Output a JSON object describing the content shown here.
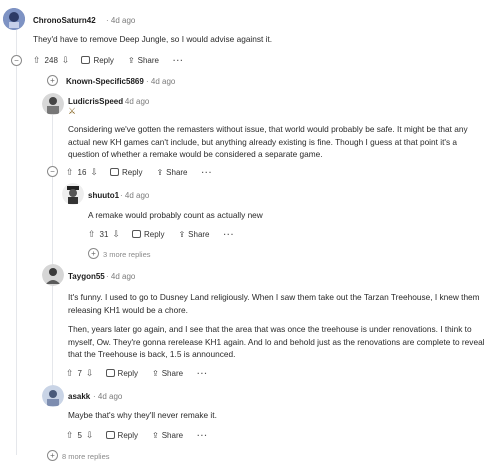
{
  "comments": {
    "c1": {
      "username": "ChronoSaturn42",
      "time": "· 4d ago",
      "text": "They'd have to remove Deep Jungle, so I would advise against it.",
      "votes": "248",
      "reply": "Reply",
      "share": "Share",
      "more": "···"
    },
    "c2": {
      "username": "Known-Specific5869",
      "time": "· 4d ago"
    },
    "c3": {
      "username": "LudicrisSpeed",
      "time": "· 4d ago",
      "text": "Considering we've gotten the remasters without issue, that world would probably be safe. It might be that any actual new KH games can't include, but anything already existing is fine. Though I guess at that point it's a question of whether a remake would be considered a separate game.",
      "votes": "16",
      "reply": "Reply",
      "share": "Share",
      "more": "···"
    },
    "c4": {
      "username": "shuuto1",
      "time": "· 4d ago",
      "text": "A remake would probably count as actually new",
      "votes": "31",
      "reply": "Reply",
      "share": "Share",
      "more": "···",
      "more_replies": "3 more replies"
    },
    "c5": {
      "username": "Taygon55",
      "time": "· 4d ago",
      "text1": "It's funny. I used to go to Dusney Land religiously. When I saw them take out the Tarzan Treehouse, I knew them releasing KH1 would be a chore.",
      "text2": "Then, years later go again, and I see that the area that was once the treehouse is under renovations. I think to myself, Ow. They're gonna rerelease KH1 again. And lo and behold just as the renovations are complete to reveal that the Treehouse is back, 1.5 is announced.",
      "votes": "7",
      "reply": "Reply",
      "share": "Share",
      "more": "···"
    },
    "c6": {
      "username": "asakk",
      "time": "· 4d ago",
      "text": "Maybe that's why they'll never remake it.",
      "votes": "5",
      "reply": "Reply",
      "share": "Share",
      "more": "···"
    }
  },
  "footer": {
    "more_replies": "8 more replies"
  },
  "icons": {
    "upvote": "up-arrow-icon",
    "downvote": "down-arrow-icon",
    "reply": "speech-bubble-icon",
    "share": "share-icon",
    "collapse": "minus-circle-icon",
    "expand": "plus-circle-icon"
  },
  "colors": {
    "thread_line": "#e5e7eb",
    "text": "#1a1a1b",
    "muted": "#7c7c7c"
  }
}
